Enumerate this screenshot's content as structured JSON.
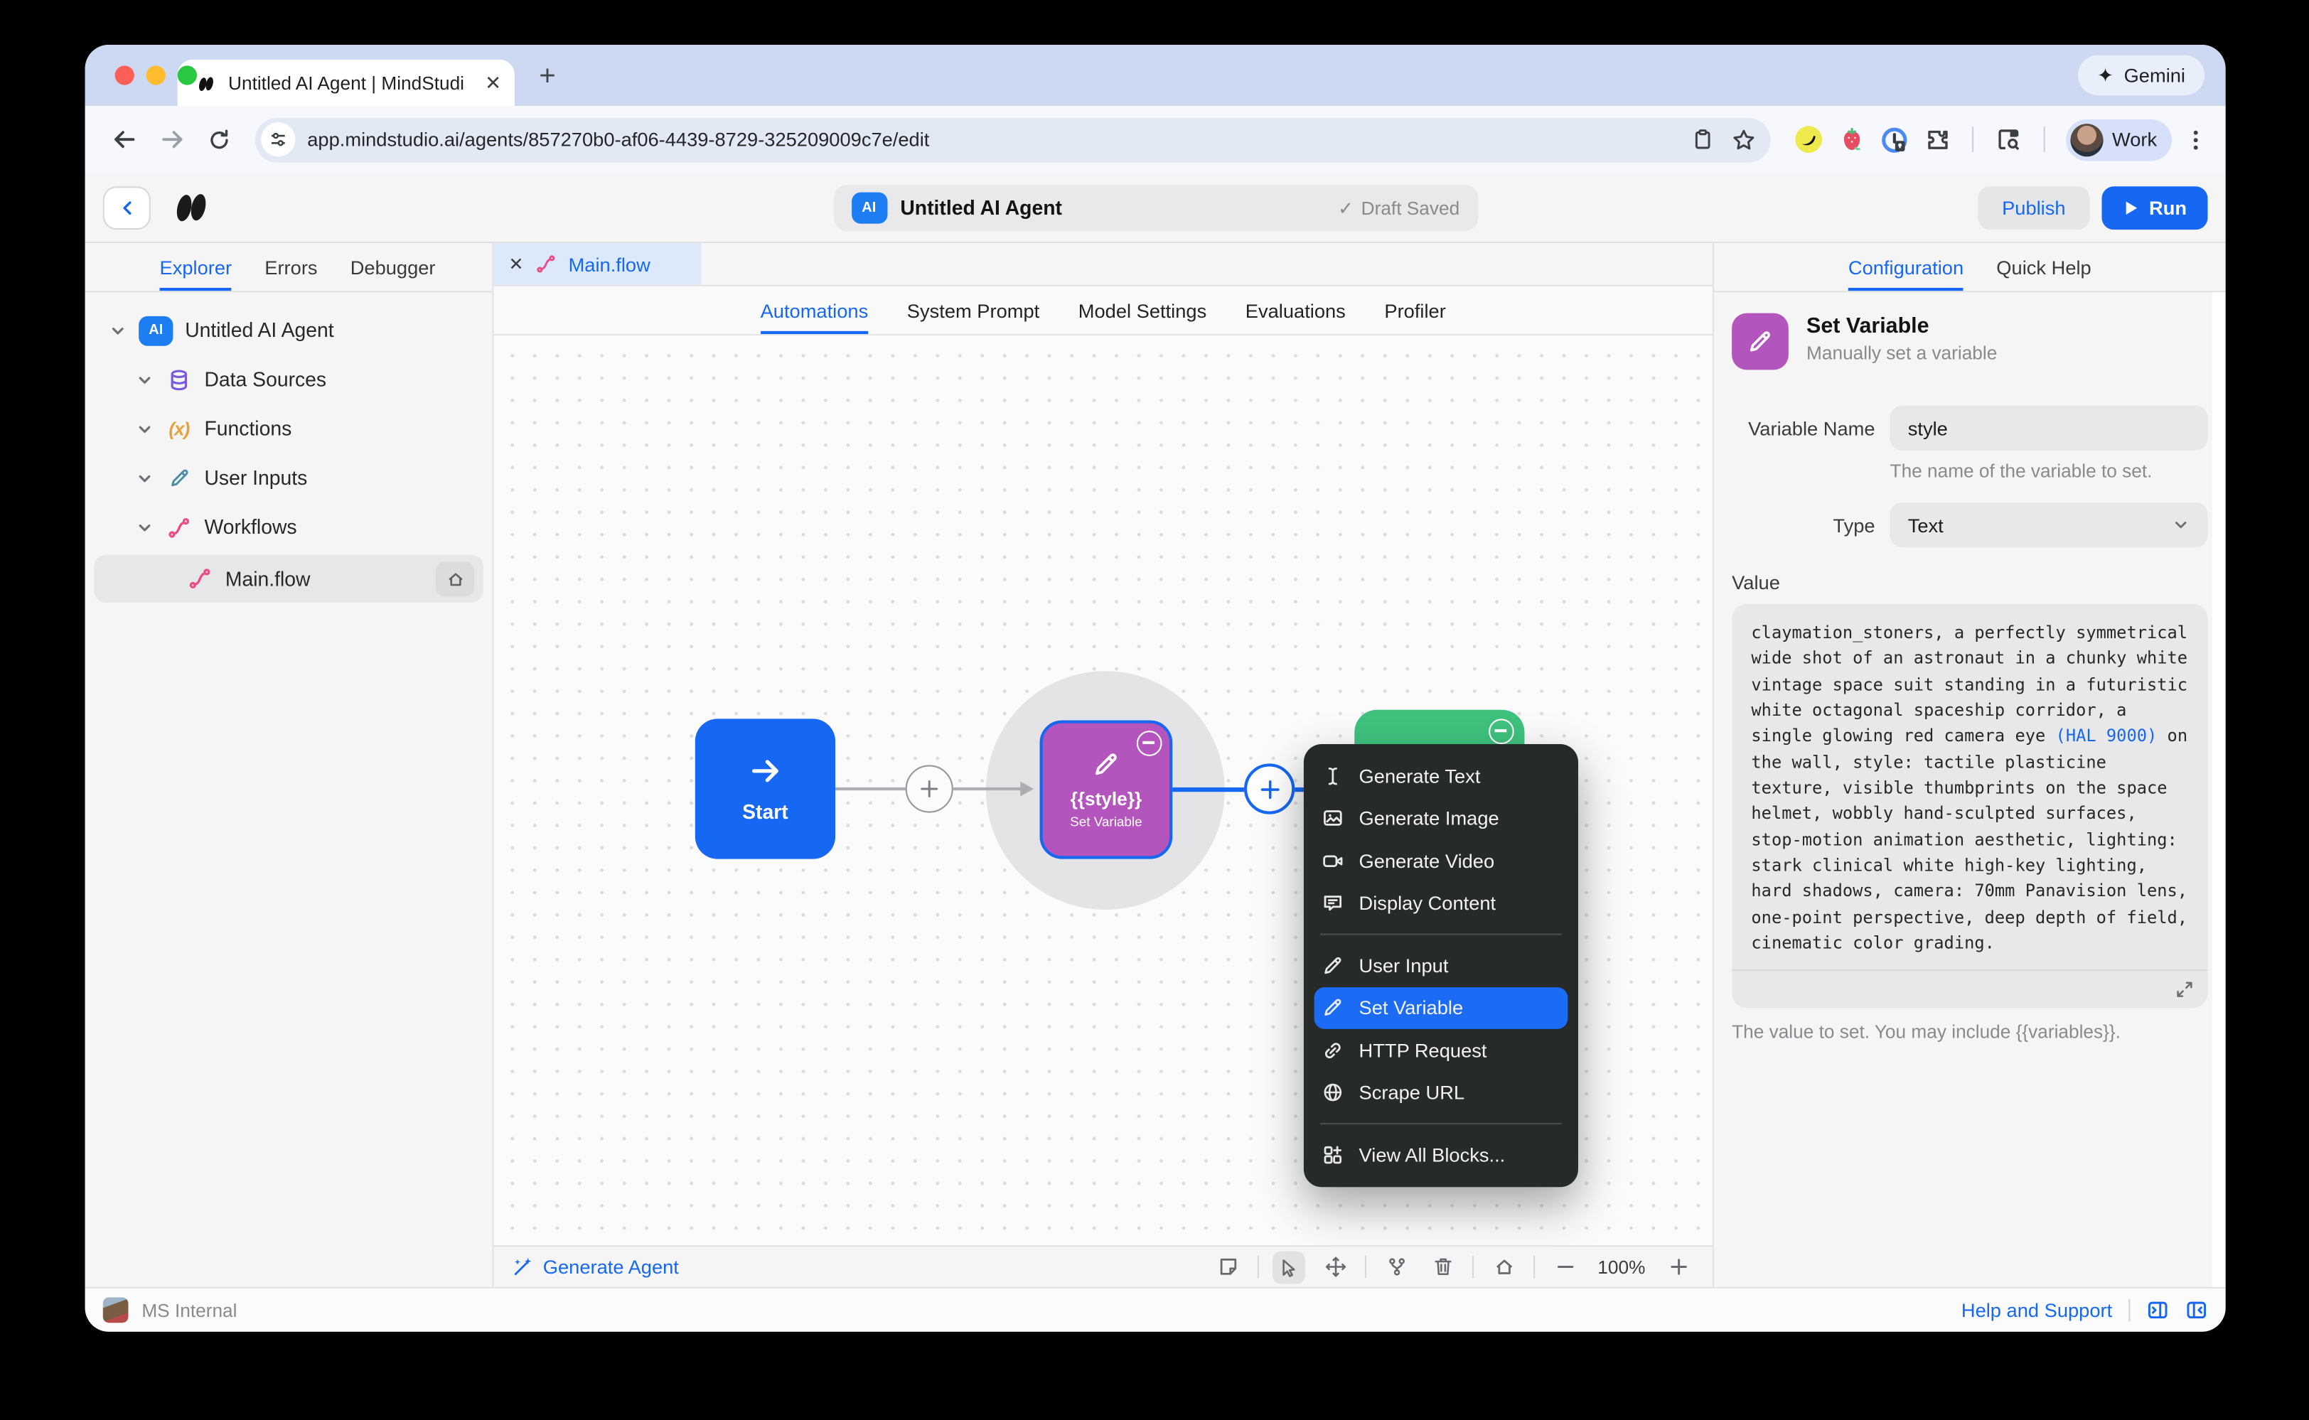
{
  "browser": {
    "tab_title": "Untitled AI Agent | MindStudi",
    "url": "app.mindstudio.ai/agents/857270b0-af06-4439-8729-325209009c7e/edit",
    "gemini_label": "Gemini",
    "gemini_glyph": "✦",
    "profile_label": "Work",
    "close_glyph": "✕",
    "newtab_glyph": "+"
  },
  "header": {
    "agent_badge": "AI",
    "title": "Untitled AI Agent",
    "draft_check": "✓",
    "draft_status": "Draft Saved",
    "publish": "Publish",
    "run": "Run"
  },
  "sidebar": {
    "tabs": [
      "Explorer",
      "Errors",
      "Debugger"
    ],
    "root": "Untitled AI Agent",
    "root_badge": "AI",
    "items": [
      "Data Sources",
      "Functions",
      "User Inputs",
      "Workflows"
    ],
    "fx_glyph": "(x)",
    "flow": "Main.flow"
  },
  "editor": {
    "tab": "Main.flow",
    "tab_close": "✕",
    "nav": [
      "Automations",
      "System Prompt",
      "Model Settings",
      "Evaluations",
      "Profiler"
    ]
  },
  "canvas": {
    "start": "Start",
    "node_title": "{{style}}",
    "node_subtitle": "Set Variable",
    "generate_agent": "Generate Agent",
    "zoom": "100%"
  },
  "menu": {
    "items": [
      "Generate Text",
      "Generate Image",
      "Generate Video",
      "Display Content",
      "User Input",
      "Set Variable",
      "HTTP Request",
      "Scrape URL",
      "View All Blocks..."
    ]
  },
  "panel": {
    "tabs": [
      "Configuration",
      "Quick Help"
    ],
    "block_title": "Set Variable",
    "block_subtitle": "Manually set a variable",
    "name_label": "Variable Name",
    "name_value": "style",
    "name_help": "The name of the variable to set.",
    "type_label": "Type",
    "type_value": "Text",
    "value_label": "Value",
    "value_before": "claymation_stoners, a perfectly symmetrical\nwide shot of an astronaut in a chunky white\nvintage space suit standing in a futuristic\nwhite octagonal spaceship corridor, a\nsingle glowing red camera eye ",
    "value_hal": "(HAL 9000)",
    "value_after": " on\nthe wall, style: tactile plasticine\ntexture, visible thumbprints on the space\nhelmet, wobbly hand-sculpted surfaces,\nstop-motion animation aesthetic, lighting:\nstark clinical white high-key lighting,\nhard shadows, camera: 70mm Panavision lens,\none-point perspective, deep depth of field,\ncinematic color grading.",
    "value_help": "The value to set. You may include {{variables}}."
  },
  "statusbar": {
    "workspace": "MS Internal",
    "help": "Help and Support"
  },
  "colors": {
    "accent": "#1667F2",
    "node_purple": "#B455BE",
    "node_green": "#3FC27E",
    "menu_bg": "#262B2A"
  }
}
